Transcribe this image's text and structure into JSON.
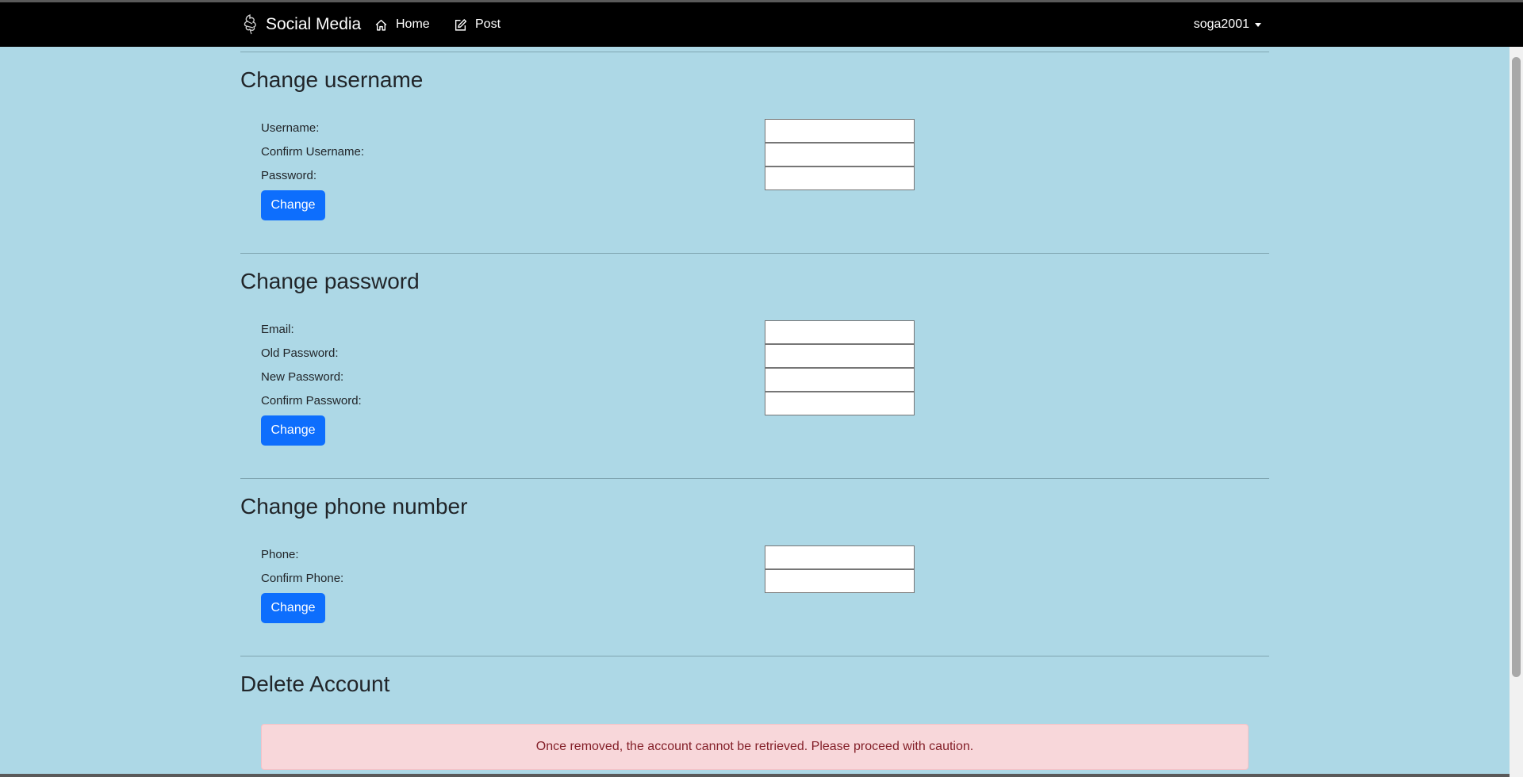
{
  "navbar": {
    "brand": "Social Media",
    "brand_icon": "dragon-logo-icon",
    "links": [
      {
        "label": "Home",
        "icon": "house-icon"
      },
      {
        "label": "Post",
        "icon": "edit-icon"
      }
    ],
    "user": "soga2001"
  },
  "sections": {
    "username": {
      "title": "Change username",
      "fields": [
        "Username:",
        "Confirm Username:",
        "Password:"
      ],
      "button": "Change"
    },
    "password": {
      "title": "Change password",
      "fields": [
        "Email:",
        "Old Password:",
        "New Password:",
        "Confirm Password:"
      ],
      "button": "Change"
    },
    "phone": {
      "title": "Change phone number",
      "fields": [
        "Phone:",
        "Confirm Phone:"
      ],
      "button": "Change"
    },
    "delete": {
      "title": "Delete Account",
      "warning": "Once removed, the account cannot be retrieved. Please proceed with caution."
    }
  },
  "colors": {
    "page_background": "#add8e6",
    "navbar": "#000000",
    "primary_button": "#0d6efd",
    "alert_background": "#f8d7da",
    "alert_text": "#842029"
  }
}
